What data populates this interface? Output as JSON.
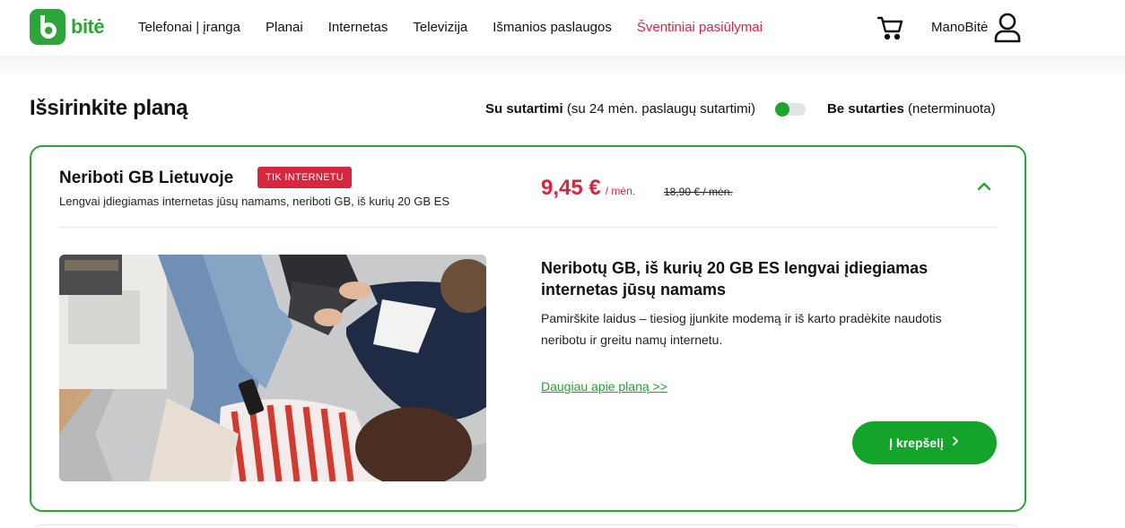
{
  "brand": {
    "logo_text": "bitė",
    "accent": "#2ea53a"
  },
  "nav": {
    "items": [
      "Telefonai | įranga",
      "Planai",
      "Internetas",
      "Televizija",
      "Išmanios paslaugos",
      "Šventiniai pasiūlymai"
    ],
    "promo_color": "#d7263d"
  },
  "header": {
    "cart_icon": "cart-icon",
    "account_label": "ManoBitė",
    "account_icon": "user-icon"
  },
  "page": {
    "title": "Išsirinkite planą"
  },
  "contract": {
    "option_a_bold": "Su sutartimi",
    "option_a_note": "(su 24 mėn. paslaugų sutartimi)",
    "option_b_bold": "Be sutarties",
    "option_b_note": "(neterminuota)",
    "selected": "Su sutartimi"
  },
  "plan": {
    "name": "Neriboti GB Lietuvoje",
    "badge": "TIK INTERNETU",
    "subtitle": "Lengvai įdiegiamas internetas jūsų namams, neriboti GB, iš kurių 20 GB ES",
    "price": "9,45 €",
    "price_unit": "/ mėn.",
    "old_price": "18,90 € / mėn.",
    "detail_title": "Neribotų GB, iš kurių 20 GB ES lengvai įdiegiamas internetas jūsų namams",
    "detail_desc": "Pamirškite laidus – tiesiog įjunkite modemą ir iš karto pradėkite naudotis neribotu ir greitu namų internetu.",
    "more_link": "Daugiau apie planą >>",
    "cta": "Į krepšelį",
    "cta_icon": "chevron-right-icon",
    "collapse_icon": "chevron-up-icon"
  }
}
